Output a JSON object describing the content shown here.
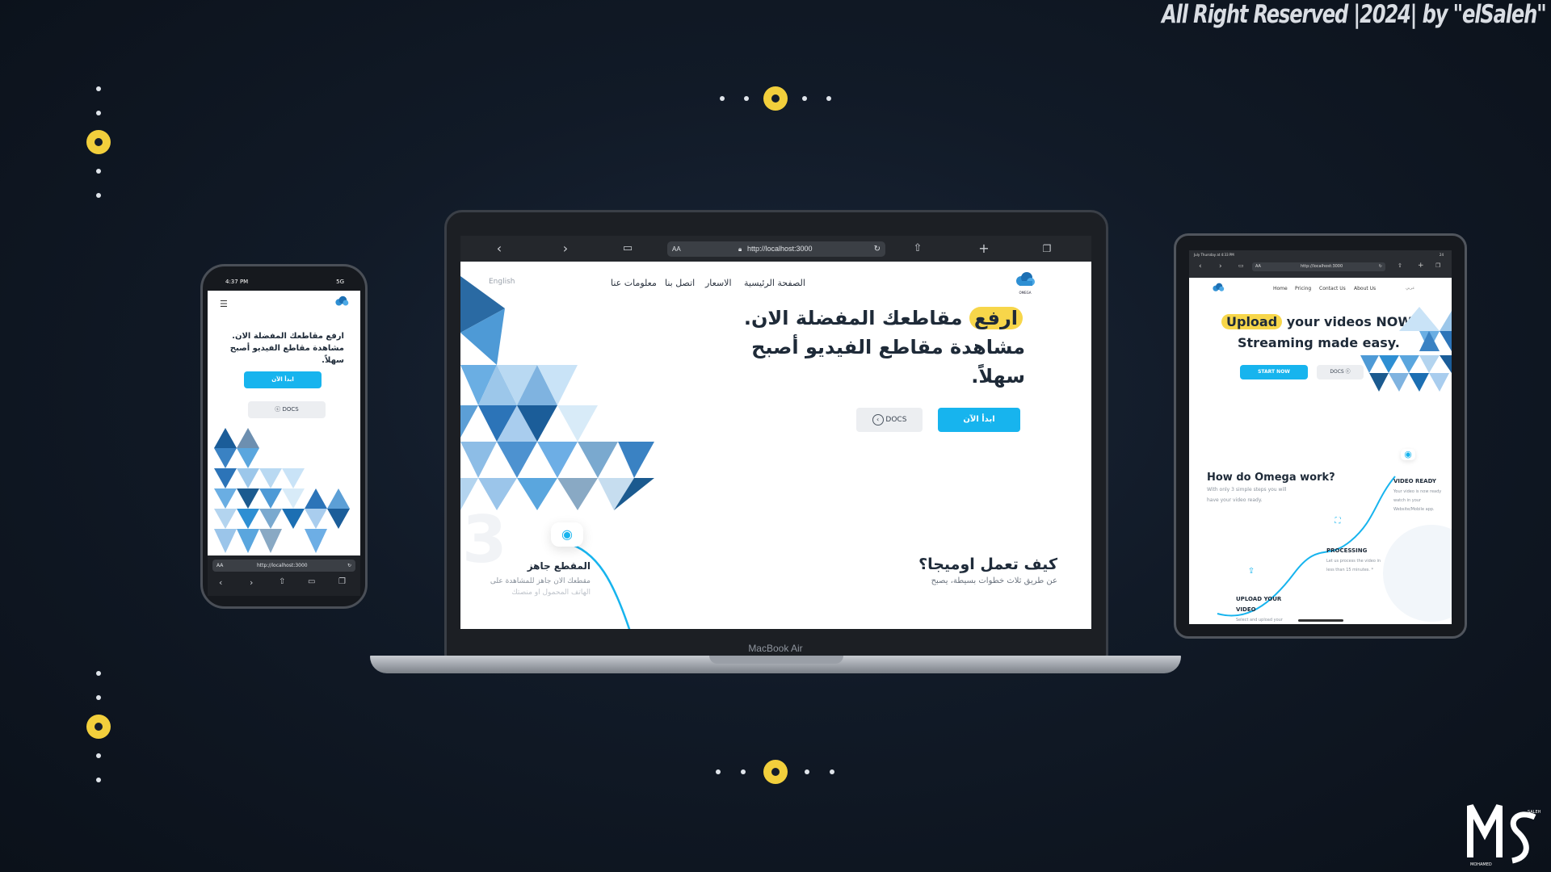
{
  "copyright": "All Right Reserved |2024| by \"elSaleh\"",
  "brand": {
    "logo_text": "OMEGA",
    "signature_first": "SALEH",
    "signature_last": "MOHAMED"
  },
  "laptop": {
    "device_label": "MacBook Air",
    "browser": {
      "url": "http://localhost:3000",
      "text_size": "AA"
    },
    "nav": {
      "lang": "English",
      "about": "معلومات عنا",
      "contact": "اتصل بنا",
      "pricing": "الاسعار",
      "home": "الصفحة الرئيسية"
    },
    "hero": {
      "highlight": "ارفع",
      "line1": "مقاطعك المفضلة الان.",
      "line2": "مشاهدة مقاطع الفيديو أصبح",
      "line3": "سهلاً.",
      "start_button": "ابدأ الآن",
      "docs_button": "DOCS"
    },
    "how": {
      "title": "كيف تعمل اوميجا؟",
      "subtitle": "عن طريق ثلاث خطوات بسيطة، يصبح",
      "step_title": "المقطع جاهز",
      "step_desc1": "مقطعك الان جاهز للمشاهدة على",
      "step_desc2": "الهاتف المحمول او منصتك",
      "step_number": "3"
    }
  },
  "phone": {
    "time": "4:37 PM",
    "signal": "5G",
    "hero": {
      "highlight": "ارفع",
      "line1": "مقاطعك المفضلة الان.",
      "line2": "مشاهدة مقاطع الفيديو أصبح",
      "line3": "سهلاً.",
      "start_button": "ابدأ الآن",
      "docs_button": "DOCS"
    },
    "browser": {
      "url": "http://localhost:3000",
      "text_size": "AA"
    }
  },
  "tablet": {
    "time": "July Thursday at 4:33 PM",
    "battery": "24",
    "browser": {
      "url": "http://localhost:3000",
      "text_size": "AA"
    },
    "nav": {
      "home": "Home",
      "pricing": "Pricing",
      "contact": "Contact Us",
      "about": "About Us",
      "lang": "عربي"
    },
    "hero": {
      "highlight": "Upload",
      "line1": "your videos NOW.",
      "line2": "Streaming made easy.",
      "start_button": "START NOW",
      "docs_button": "DOCS"
    },
    "how": {
      "title": "How do Omega work?",
      "desc1": "With only 3 simple steps you will",
      "desc2": "have your video ready."
    },
    "steps": [
      {
        "title": "VIDEO READY",
        "desc": [
          "Your video is now ready",
          "watch in your",
          "Website/Mobile app."
        ]
      },
      {
        "title": "PROCESSING",
        "desc": [
          "Let us process the video in",
          "less than 15 minutes. *"
        ]
      },
      {
        "title": "UPLOAD YOUR",
        "title2": "VIDEO",
        "desc": [
          "Select and upload your"
        ]
      }
    ]
  },
  "colors": {
    "accent_yellow": "#f2cf3c",
    "cyan": "#17b4ee",
    "background": "#111a27"
  }
}
